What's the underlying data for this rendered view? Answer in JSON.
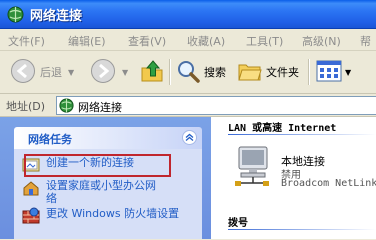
{
  "window": {
    "title": "网络连接"
  },
  "menu": [
    "文件(F)",
    "编辑(E)",
    "查看(V)",
    "收藏(A)",
    "工具(T)",
    "高级(N)",
    "帮助"
  ],
  "toolbar": {
    "back": "后退",
    "search": "搜索",
    "folders": "文件夹"
  },
  "address": {
    "label": "地址(D)",
    "value": "网络连接"
  },
  "tasks": {
    "title": "网络任务",
    "items": [
      {
        "label": "创建一个新的连接"
      },
      {
        "label": "设置家庭或小型办公网络"
      },
      {
        "label": "更改 Windows 防火墙设置"
      }
    ]
  },
  "groups": [
    {
      "title": "LAN 或高速 Internet"
    },
    {
      "title": "拨号"
    }
  ],
  "connection": {
    "name": "本地连接",
    "status": "禁用",
    "device": "Broadcom NetLink"
  },
  "colors": {
    "title_bar": "#2b74f3",
    "task_text": "#215dc6",
    "highlight": "#c0262d"
  }
}
